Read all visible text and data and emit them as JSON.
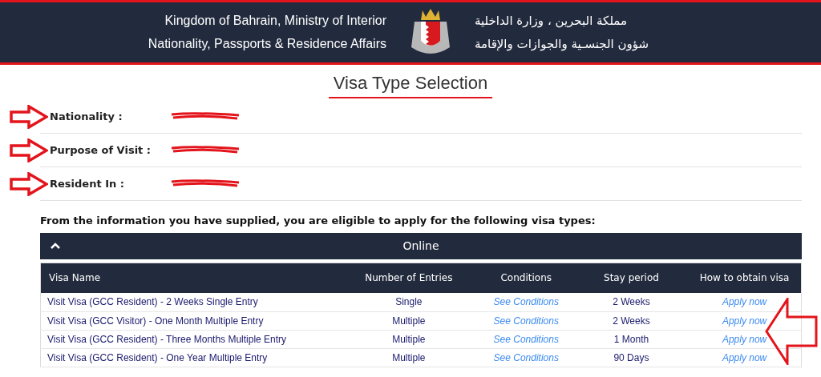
{
  "header": {
    "english_lines": [
      "Kingdom of Bahrain, Ministry of Interior",
      "Nationality, Passports & Residence Affairs"
    ],
    "arabic_lines": [
      "مملكة البحرين ، وزارة الداخلية",
      "شؤون الجنسـية والجوازات والإقامة"
    ]
  },
  "title": "Visa Type Selection",
  "details": [
    {
      "label": "Nationality :",
      "redacted": true
    },
    {
      "label": "Purpose of Visit :",
      "redacted": true
    },
    {
      "label": "Resident In :",
      "redacted": true
    }
  ],
  "intro": "From the information you have supplied, you are eligible to apply for the following visa types:",
  "section": {
    "title": "Online",
    "expanded": true
  },
  "table": {
    "columns": [
      "Visa Name",
      "Number of Entries",
      "Conditions",
      "Stay period",
      "How to obtain visa"
    ],
    "rows": [
      {
        "visa_name": "Visit Visa (GCC Resident) - 2 Weeks Single Entry",
        "entries": "Single",
        "conditions": "See Conditions",
        "stay": "2 Weeks",
        "action": "Apply now"
      },
      {
        "visa_name": "Visit Visa (GCC Visitor) - One Month Multiple Entry",
        "entries": "Multiple",
        "conditions": "See Conditions",
        "stay": "2 Weeks",
        "action": "Apply now"
      },
      {
        "visa_name": "Visit Visa (GCC Resident) - Three Months Multiple Entry",
        "entries": "Multiple",
        "conditions": "See Conditions",
        "stay": "1 Month",
        "action": "Apply now"
      },
      {
        "visa_name": "Visit Visa (GCC Resident) - One Year Multiple Entry",
        "entries": "Multiple",
        "conditions": "See Conditions",
        "stay": "90 Days",
        "action": "Apply now"
      }
    ]
  }
}
